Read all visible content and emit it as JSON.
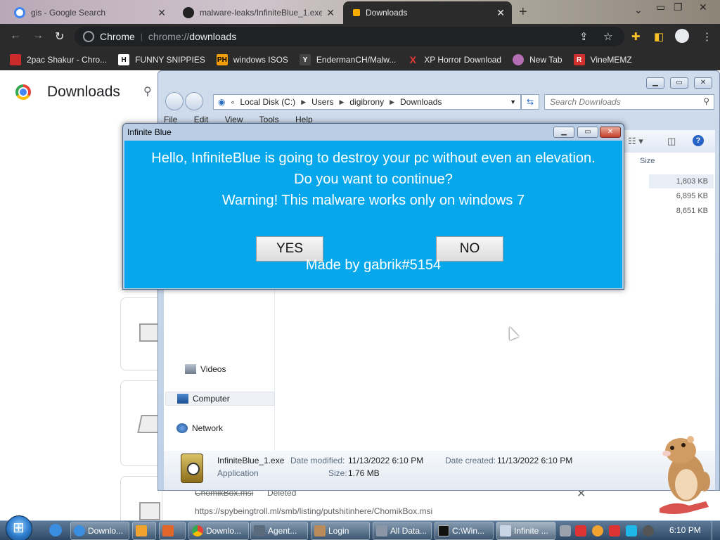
{
  "browser": {
    "tabs": [
      {
        "label": "gis - Google Search",
        "active": false
      },
      {
        "label": "malware-leaks/InfiniteBlue_1.exe",
        "active": false
      },
      {
        "label": "Downloads",
        "active": true
      }
    ],
    "omnibox": {
      "chip_label": "Chrome",
      "url_scheme": "chrome://",
      "url_host": "downloads"
    },
    "bookmarks": [
      {
        "label": "2pac Shakur - Chro...",
        "badge": "",
        "color": "#cc2b2b"
      },
      {
        "label": "FUNNY SNIPPIES",
        "badge": "H",
        "color": "#ffffff"
      },
      {
        "label": "windows ISOS",
        "badge": "PH",
        "color": "#f59e0b"
      },
      {
        "label": "EndermanCH/Malw...",
        "badge": "Y",
        "color": "#2b2b2b"
      },
      {
        "label": "XP Horror Download",
        "badge": "X",
        "color": "#e53935"
      },
      {
        "label": "New Tab",
        "badge": "",
        "color": "#b46fb4"
      },
      {
        "label": "VineMEMZ",
        "badge": "R",
        "color": "#d32f2f"
      }
    ]
  },
  "downloads_page": {
    "title": "Downloads",
    "item": {
      "filename": "ChomikBox.msi",
      "status": "Deleted",
      "url": "https://spybeingtroll.ml/smb/listing/putshitinhere/ChomikBox.msi"
    }
  },
  "explorer": {
    "breadcrumb": [
      "Local Disk (C:)",
      "Users",
      "digibrony",
      "Downloads"
    ],
    "search_placeholder": "Search Downloads",
    "menu": [
      "File",
      "Edit",
      "View",
      "Tools",
      "Help"
    ],
    "size_header": "Size",
    "sizes": [
      "1,803 KB",
      "6,895 KB",
      "8,651 KB"
    ],
    "nav_items": [
      {
        "label": "Videos",
        "selected": false
      },
      {
        "label": "Computer",
        "selected": true
      },
      {
        "label": "Network",
        "selected": false
      }
    ],
    "details": {
      "filename": "InfiniteBlue_1.exe",
      "type": "Application",
      "modified_label": "Date modified:",
      "modified_value": "11/13/2022 6:10 PM",
      "created_label": "Date created:",
      "created_value": "11/13/2022 6:10 PM",
      "size_label": "Size:",
      "size_value": "1.76 MB"
    }
  },
  "dialog": {
    "title": "Infinite Blue",
    "line1": "Hello, InfiniteBlue is going to destroy your pc without even an elevation.",
    "line2": "Do you want to continue?",
    "line3": "Warning! This malware works only on windows 7",
    "yes_label": "YES",
    "no_label": "NO",
    "credit": "Made by gabrik#5154",
    "bg_color": "#07a7ec"
  },
  "taskbar": {
    "items": [
      {
        "label": "Downlo...",
        "icon_color": "#3b8de0"
      },
      {
        "label": "",
        "icon_color": "#f0a32e"
      },
      {
        "label": "",
        "icon_color": "#e0662b"
      },
      {
        "label": "Downlo...",
        "icon_color": "#e53935"
      },
      {
        "label": "Agent...",
        "icon_color": "#5a6b7d"
      },
      {
        "label": "Login",
        "icon_color": "#b98b5a"
      },
      {
        "label": "All Data...",
        "icon_color": "#8a96a6"
      },
      {
        "label": "C:\\Win...",
        "icon_color": "#111111"
      },
      {
        "label": "Infinite ...",
        "icon_color": "#c9d6e6"
      }
    ],
    "clock": "6:10 PM"
  }
}
